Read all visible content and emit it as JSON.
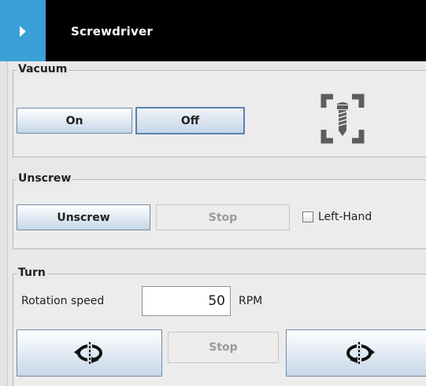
{
  "header": {
    "title": "Screwdriver",
    "tab_icon": "chevron-right-icon"
  },
  "vacuum": {
    "title": "Vacuum",
    "on_label": "On",
    "off_label": "Off",
    "icon": "screw-target-icon"
  },
  "unscrew": {
    "title": "Unscrew",
    "unscrew_label": "Unscrew",
    "stop_label": "Stop",
    "left_hand_label": "Left-Hand",
    "left_hand_checked": false
  },
  "turn": {
    "title": "Turn",
    "rotation_label": "Rotation speed",
    "rotation_value": "50",
    "unit_label": "RPM",
    "ccw_icon": "rotate-counterclockwise-icon",
    "stop_label": "Stop",
    "cw_icon": "rotate-clockwise-icon"
  },
  "colors": {
    "accent": "#3aa0d8",
    "header_bg": "#000000",
    "panel_bg": "#e8e8e8"
  }
}
